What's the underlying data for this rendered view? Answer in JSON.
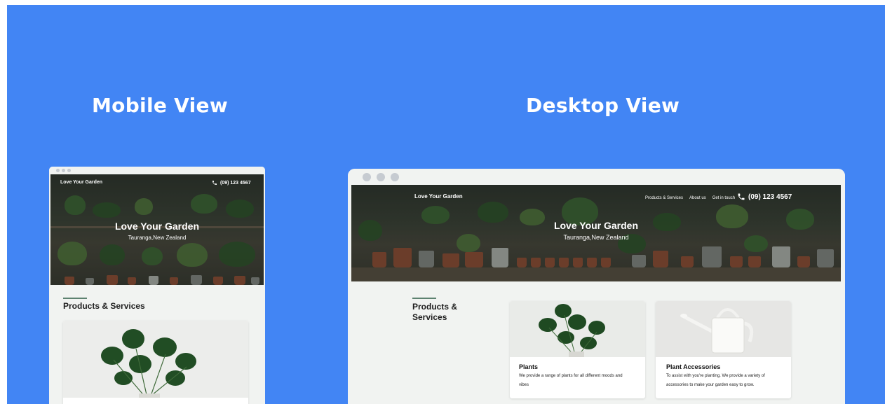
{
  "labels": {
    "mobile": "Mobile View",
    "desktop": "Desktop View"
  },
  "site": {
    "brand": "Love Your Garden",
    "phone": "(09) 123 4567",
    "hero_title": "Love Your Garden",
    "hero_subtitle": "Tauranga,New Zealand",
    "nav": [
      "Products & Services",
      "About us",
      "Get in touch"
    ],
    "section_title": "Products & Services",
    "section_title_line1": "Products &",
    "section_title_line2": "Services",
    "cards": [
      {
        "title": "Plants",
        "line1": "We provide a range of plants for all different moods and",
        "line2": "vibes"
      },
      {
        "title": "Plant Accessories",
        "line1": "To assist with you're planting. We provide a variety of",
        "line2": "accessories to make your garden easy to grow."
      }
    ]
  },
  "colors": {
    "background": "#4285f4",
    "frame": "#f1f3f1",
    "accent_rule": "#5d8270"
  },
  "icons": {
    "phone": "phone-icon",
    "window_dots": "window-dot-icon"
  }
}
